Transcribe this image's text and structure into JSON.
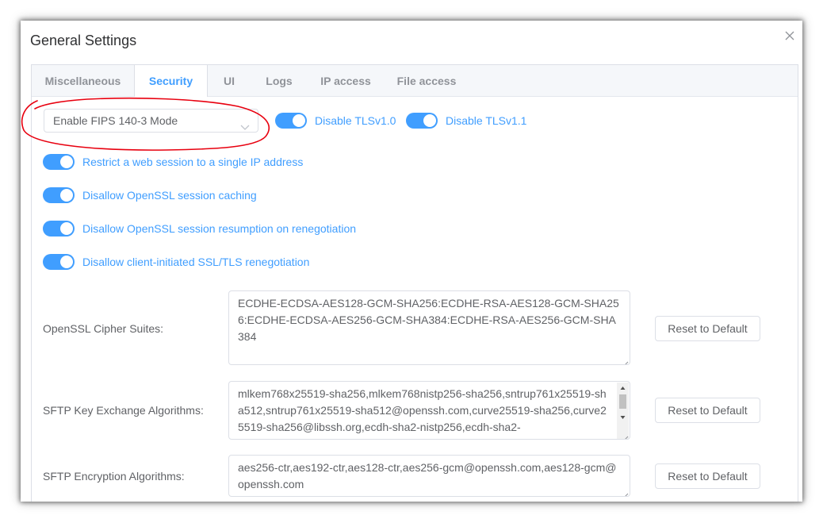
{
  "dialog": {
    "title": "General Settings",
    "close_icon": "close-icon"
  },
  "tabs": [
    {
      "label": "Miscellaneous",
      "active": false
    },
    {
      "label": "Security",
      "active": true
    },
    {
      "label": "UI",
      "active": false
    },
    {
      "label": "Logs",
      "active": false
    },
    {
      "label": "IP access",
      "active": false
    },
    {
      "label": "File access",
      "active": false
    }
  ],
  "security": {
    "fips_select": {
      "value": "Enable FIPS 140-3 Mode",
      "icon": "chevron-down-icon"
    },
    "toggles": [
      {
        "label": "Disable TLSv1.0",
        "on": true
      },
      {
        "label": "Disable TLSv1.1",
        "on": true
      },
      {
        "label": "Restrict a web session to a single IP address",
        "on": true
      },
      {
        "label": "Disallow OpenSSL session caching",
        "on": true
      },
      {
        "label": "Disallow OpenSSL session resumption on renegotiation",
        "on": true
      },
      {
        "label": "Disallow client-initiated SSL/TLS renegotiation",
        "on": true
      }
    ],
    "cipher_suites": {
      "label": "OpenSSL Cipher Suites:",
      "value": "ECDHE-ECDSA-AES128-GCM-SHA256:ECDHE-RSA-AES128-GCM-SHA256:ECDHE-ECDSA-AES256-GCM-SHA384:ECDHE-RSA-AES256-GCM-SHA384",
      "reset_label": "Reset to Default"
    },
    "kex": {
      "label": "SFTP Key Exchange Algorithms:",
      "value": "mlkem768x25519-sha256,mlkem768nistp256-sha256,sntrup761x25519-sha512,sntrup761x25519-sha512@openssh.com,curve25519-sha256,curve25519-sha256@libssh.org,ecdh-sha2-nistp256,ecdh-sha2-",
      "reset_label": "Reset to Default"
    },
    "encryption": {
      "label": "SFTP Encryption Algorithms:",
      "value": "aes256-ctr,aes192-ctr,aes128-ctr,aes256-gcm@openssh.com,aes128-gcm@openssh.com",
      "reset_label": "Reset to Default"
    }
  },
  "colors": {
    "accent": "#409eff",
    "annotation": "#e8000f"
  }
}
